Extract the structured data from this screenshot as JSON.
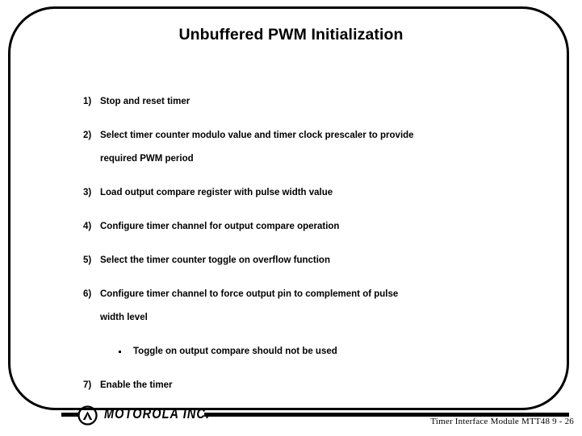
{
  "slide": {
    "title": "Unbuffered PWM Initialization",
    "items": [
      {
        "marker": "1)",
        "text": "Stop and reset timer",
        "continuation": ""
      },
      {
        "marker": "2)",
        "text": "Select timer counter modulo value and timer clock prescaler to provide",
        "continuation": "required PWM period"
      },
      {
        "marker": "3)",
        "text": "Load output compare register with pulse width value",
        "continuation": ""
      },
      {
        "marker": "4)",
        "text": "Configure timer channel for output compare operation",
        "continuation": ""
      },
      {
        "marker": "5)",
        "text": "Select the timer counter toggle on overflow function",
        "continuation": ""
      },
      {
        "marker": "6)",
        "text": "Configure timer channel to force output pin to complement of pulse",
        "continuation": "width level"
      }
    ],
    "sub_bullet": {
      "bullet_glyph": "square-bullet",
      "text": "Toggle on output compare should not be used"
    },
    "last_item": {
      "marker": "7)",
      "text": "Enable the timer",
      "continuation": ""
    }
  },
  "logo": {
    "mark_name": "motorola-batwing-icon",
    "wordmark": "MOTOROLA INC."
  },
  "footer": {
    "text": "Timer Interface Module MTT48  9 - 26"
  },
  "colors": {
    "text": "#000000",
    "background": "#ffffff",
    "border": "#000000"
  }
}
